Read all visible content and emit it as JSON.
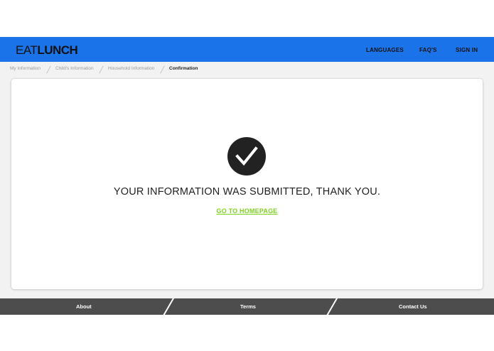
{
  "header": {
    "logo_eat": "EAT",
    "logo_lunch": "LUNCH",
    "nav": {
      "languages": "LANGUAGES",
      "faqs": "FAQ'S",
      "sign_in": "SIGN IN"
    }
  },
  "breadcrumb": {
    "items": [
      {
        "label": "My Information"
      },
      {
        "label": "Child's Information"
      },
      {
        "label": "Household Information"
      },
      {
        "label": "Confirmation"
      }
    ]
  },
  "confirmation": {
    "icon": "checkmark-circle-icon",
    "message": "YOUR INFORMATION WAS SUBMITTED, THANK YOU.",
    "link_label": "GO TO HOMEPAGE"
  },
  "footer": {
    "about": "About",
    "terms": "Terms",
    "contact": "Contact Us"
  },
  "colors": {
    "header_blue": "#1a73e8",
    "link_green": "#7ed321",
    "footer_gray": "#4d4d4d",
    "page_gray": "#f2f2f2"
  }
}
